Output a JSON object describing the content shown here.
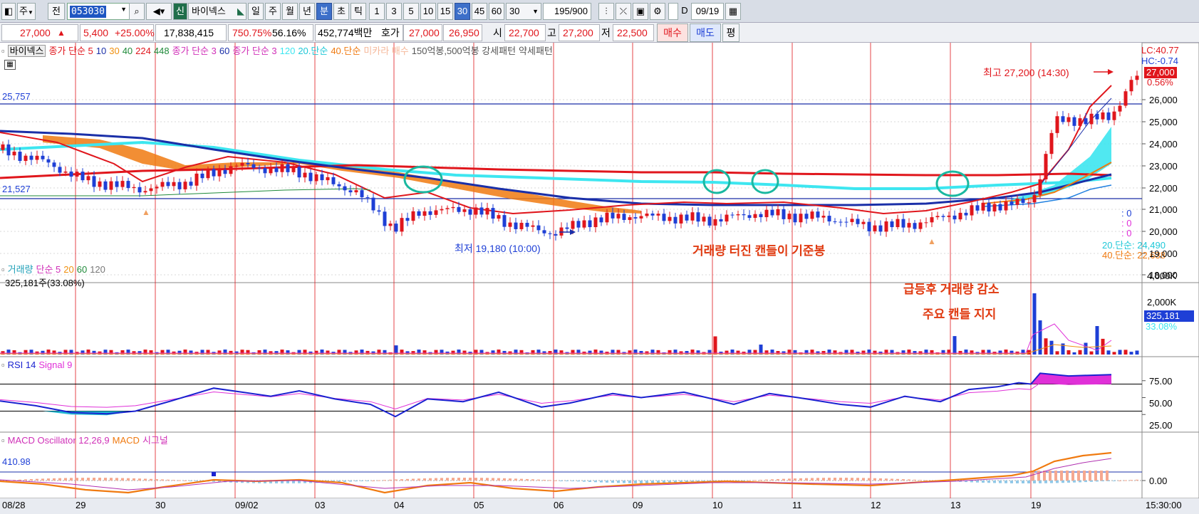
{
  "toolbar": {
    "type_select": "주",
    "prev_btn": "전",
    "stock_code": "053030",
    "credit_tag": "신",
    "stock_name": "바이넥스",
    "periods": [
      "일",
      "주",
      "월",
      "년",
      "분",
      "초",
      "틱"
    ],
    "active_period": "분",
    "minutes": [
      "1",
      "3",
      "5",
      "10",
      "15",
      "30",
      "45",
      "60"
    ],
    "active_minute": "30",
    "minute_select": "30",
    "count": "195",
    "count_total": "/900",
    "checkbox_label": "D",
    "date": "09/19"
  },
  "quote": {
    "price": "27,000",
    "change_arrow": "▲",
    "change": "5,400",
    "change_pct": "+25.00%",
    "volume": "17,838,415",
    "vol_ratio": "750.75%",
    "turnover": "56.16%",
    "amount": "452,774백만",
    "ask_label": "호가",
    "ask": "27,000",
    "bid": "26,950",
    "open_label": "시",
    "open": "22,700",
    "high_label": "고",
    "high": "27,200",
    "low_label": "저",
    "low": "22,500",
    "buy_label": "매수",
    "sell_label": "매도",
    "eval_label": "평"
  },
  "price_panel": {
    "legend": {
      "name": "바이넥스",
      "ma_a": "종가 단순 5",
      "ma_a_10": "10",
      "ma_a_30": "30",
      "ma_a_40": "40",
      "ma_a_224": "224",
      "ma_a_448": "448",
      "ma_b": "종가 단순 3",
      "ma_b_60": "60",
      "ma_c": "종가 단순 3",
      "ma_c_120": "120",
      "ma_c_20": "20.단순",
      "ma_c_40": "40.단순",
      "ichimoku": "미카라 매수",
      "pattern": "150억봉,500억봉 강세패턴",
      "weak": "약세패턴"
    },
    "hline_label_1": "25,757",
    "hline_label_2": "21,527",
    "lc": "LC:40.77",
    "hc": "HC:-0.74",
    "current_price": "27,000",
    "current_pct": "0.56%",
    "high_note": "최고 27,200 (14:30)",
    "low_note": "최저 19,180 (10:00)",
    "zero_1": ": 0",
    "zero_2": ": 0",
    "zero_3": ": 0",
    "ma20_readout": "20.단순: 24,490",
    "ma40_readout": "40.단순: 22,638",
    "annotation_1": "거래량 터진 캔들이 기준봉",
    "y_ticks": [
      "26,000",
      "25,000",
      "24,000",
      "23,000",
      "22,000",
      "21,000",
      "20,000",
      "19,000",
      "18,000"
    ]
  },
  "volume_panel": {
    "legend_vol": "거래량",
    "legend_ma": "단순 5",
    "legend_20": "20",
    "legend_60": "60",
    "legend_120": "120",
    "info": "325,181주(33.08%)",
    "annotation_2": "급등후 거래량 감소",
    "annotation_3": "주요 캔들 지지",
    "y_ticks": [
      "4,000K",
      "2,000K"
    ],
    "current": "325,181",
    "current_pct": "33.08%"
  },
  "rsi_panel": {
    "legend_rsi": "RSI 14",
    "legend_signal": "Signal 9",
    "y_ticks": [
      "75.00",
      "50.00",
      "25.00"
    ]
  },
  "macd_panel": {
    "legend_osc": "MACD Oscillator 12,26,9",
    "legend_macd": "MACD",
    "legend_signal": "시그널",
    "value": "410.98",
    "y_tick": "0.00"
  },
  "x_axis": {
    "labels": [
      "08/28",
      "29",
      "30",
      "09/02",
      "03",
      "04",
      "05",
      "06",
      "09",
      "10",
      "11",
      "12",
      "13",
      "19"
    ],
    "time": "15:30:00"
  },
  "colors": {
    "up": "#e0161c",
    "down": "#1e3fd6",
    "ma_navy": "#1a2fa8",
    "ma_cyan": "#3de6f0",
    "ma_orange": "#f07a10",
    "cloud": "#f07a10",
    "annotation": "#e03a10",
    "rsi": "#1a22d0",
    "signal": "#e030d8"
  },
  "chart_data": [
    {
      "type": "line",
      "title": "바이넥스",
      "note": "price (candles 30-min)",
      "ylim": [
        18000,
        27600
      ],
      "x": [
        "08/28",
        "29",
        "30",
        "09/02",
        "03",
        "04",
        "05",
        "06",
        "09",
        "10",
        "11",
        "12",
        "13",
        "19"
      ],
      "series": [
        {
          "values": [
            23800,
            22300,
            22000,
            23000,
            22500,
            20200,
            21000,
            20000,
            20700,
            20600,
            20800,
            20300,
            20500,
            27000
          ]
        }
      ]
    },
    {
      "type": "line",
      "ylim": [
        0,
        100
      ],
      "series": [
        {
          "name": "RSI 14",
          "values": [
            48,
            30,
            31,
            62,
            58,
            26,
            52,
            35,
            50,
            48,
            52,
            38,
            60,
            84
          ]
        },
        {
          "name": "Signal 9",
          "values": [
            50,
            34,
            30,
            56,
            57,
            34,
            47,
            42,
            48,
            49,
            50,
            42,
            55,
            80
          ]
        }
      ]
    }
  ]
}
